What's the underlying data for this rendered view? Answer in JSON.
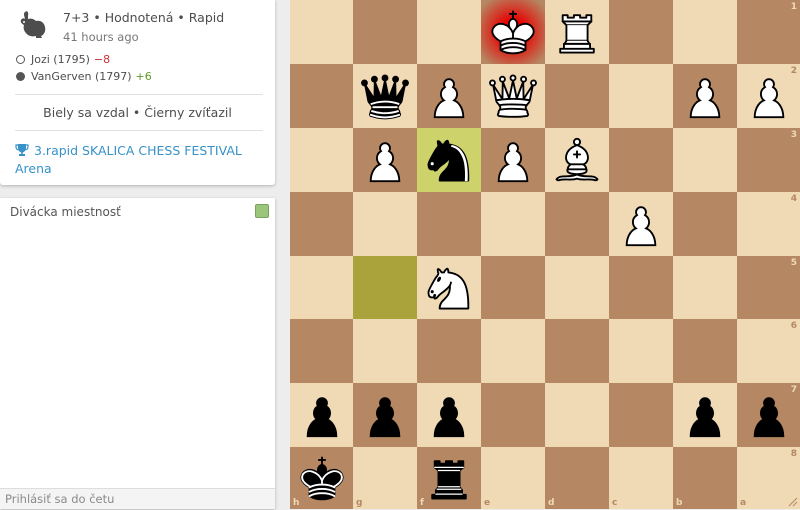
{
  "game": {
    "meta": "7+3 • Hodnotená • Rapid",
    "time": "41 hours ago",
    "white_player": "Jozi (1795)",
    "white_diff": "−8",
    "black_player": "VanGerven (1797)",
    "black_diff": "+6",
    "result": "Biely sa vzdal • Čierny zvíťazil",
    "tournament": "3.rapid SKALICA CHESS FESTIVAL Arena",
    "icon": "rabbit-icon"
  },
  "chat": {
    "title": "Divácka miestnosť",
    "input_placeholder": "Prihlásiť sa do četu"
  },
  "board": {
    "orientation": "black",
    "ranks": [
      "1",
      "2",
      "3",
      "4",
      "5",
      "6",
      "7",
      "8"
    ],
    "files": [
      "h",
      "g",
      "f",
      "e",
      "d",
      "c",
      "b",
      "a"
    ],
    "position": [
      [
        "",
        "",
        "",
        "wK",
        "wR",
        "",
        "",
        ""
      ],
      [
        "",
        "bQ",
        "wP",
        "wQ",
        "",
        "",
        "wP",
        "wP"
      ],
      [
        "",
        "wP",
        "bN",
        "wP",
        "wB",
        "",
        "",
        ""
      ],
      [
        "",
        "",
        "",
        "",
        "",
        "wP",
        "",
        ""
      ],
      [
        "",
        "",
        "wN",
        "",
        "",
        "",
        "",
        ""
      ],
      [
        "",
        "",
        "",
        "",
        "",
        "",
        "",
        ""
      ],
      [
        "bP",
        "bP",
        "bP",
        "",
        "",
        "",
        "bP",
        "bP"
      ],
      [
        "bK",
        "",
        "bR",
        "",
        "",
        "",
        "",
        ""
      ]
    ],
    "last_move": [
      "f3",
      "g5"
    ],
    "check_square": "e1"
  }
}
